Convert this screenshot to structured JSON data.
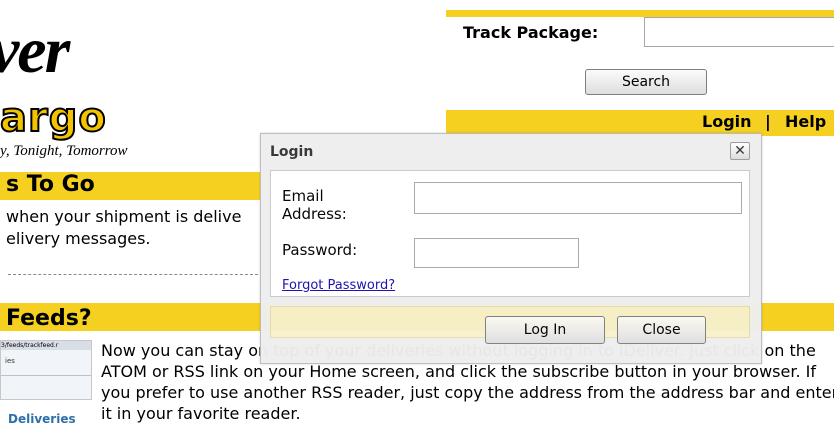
{
  "logo": {
    "top_text": "ver",
    "cargo_text": "argo",
    "tagline": "y, Tonight, Tomorrow"
  },
  "track": {
    "label": "Track Package:",
    "search_label": "Search"
  },
  "nav": {
    "login": "Login",
    "separator": "|",
    "help": "Help"
  },
  "sections": [
    {
      "title": "s To Go",
      "lines": [
        "when your shipment is delive",
        "elivery messages."
      ]
    },
    {
      "title": "Feeds?",
      "thumb_url": "3/feeds/trackfeed.r",
      "thumb_small": "ies",
      "link": "Deliveries",
      "paragraph": "Now you can stay on top of your deliveries without logging in to iDeliver. Just click on the ATOM or RSS link on your Home screen, and click the subscribe button in your browser. If you prefer to use another RSS reader, just copy the address from the address bar and enter it in your favorite reader."
    }
  ],
  "dialog": {
    "title": "Login",
    "close_glyph": "✕",
    "email_label": "Email Address:",
    "password_label": "Password:",
    "forgot_link": "Forgot Password?",
    "login_button": "Log In",
    "close_button": "Close"
  },
  "colors": {
    "brand_yellow": "#f5d020",
    "link_blue": "#1a0dab"
  }
}
